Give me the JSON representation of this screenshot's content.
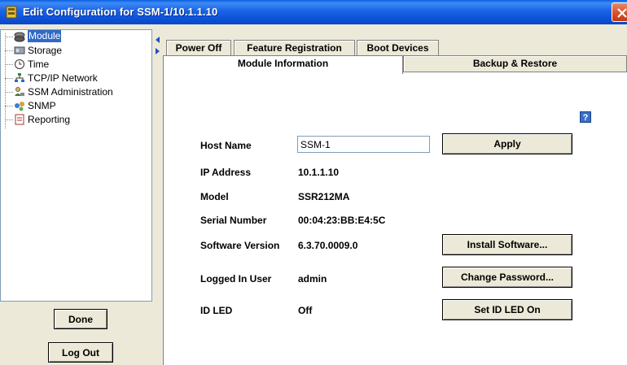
{
  "window": {
    "title": "Edit Configuration for SSM-1/10.1.1.10"
  },
  "tree": {
    "items": [
      {
        "label": "Module",
        "icon": "module-icon",
        "selected": true
      },
      {
        "label": "Storage",
        "icon": "storage-icon"
      },
      {
        "label": "Time",
        "icon": "clock-icon"
      },
      {
        "label": "TCP/IP Network",
        "icon": "network-icon"
      },
      {
        "label": "SSM Administration",
        "icon": "admin-icon"
      },
      {
        "label": "SNMP",
        "icon": "snmp-icon"
      },
      {
        "label": "Reporting",
        "icon": "report-icon"
      }
    ]
  },
  "buttons": {
    "done": "Done",
    "logout": "Log Out"
  },
  "tabs": {
    "row1": [
      "Power Off",
      "Feature Registration",
      "Boot Devices"
    ],
    "row2": [
      "Module Information",
      "Backup & Restore"
    ],
    "active": "Module Information"
  },
  "help": {
    "label": "?"
  },
  "module_info": {
    "host_name": {
      "label": "Host Name",
      "value": "SSM-1"
    },
    "ip_address": {
      "label": "IP Address",
      "value": "10.1.1.10"
    },
    "model": {
      "label": "Model",
      "value": "SSR212MA"
    },
    "serial_number": {
      "label": "Serial Number",
      "value": "00:04:23:BB:E4:5C"
    },
    "software_version": {
      "label": "Software Version",
      "value": "6.3.70.0009.0"
    },
    "logged_in_user": {
      "label": "Logged In User",
      "value": "admin"
    },
    "id_led": {
      "label": "ID LED",
      "value": "Off"
    }
  },
  "actions": {
    "apply": "Apply",
    "install_software": "Install Software...",
    "change_password": "Change Password...",
    "set_id_led": "Set ID LED On"
  },
  "colors": {
    "titlebar": "#0b50d6",
    "selection": "#316ac5",
    "window_bg": "#ece9d8"
  }
}
